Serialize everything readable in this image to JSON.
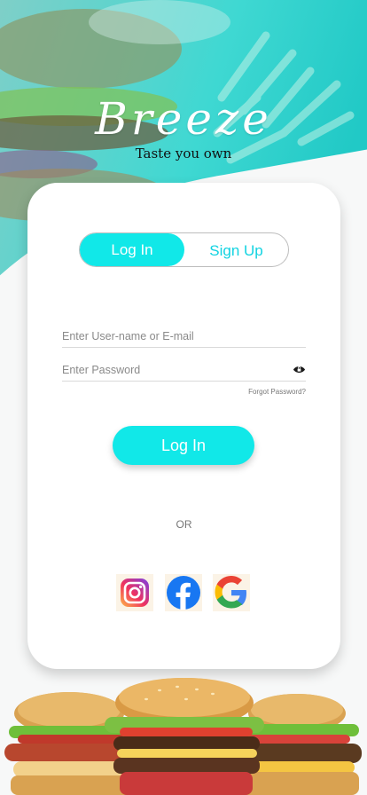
{
  "brand": {
    "title": "Breeze",
    "tagline": "Taste you own"
  },
  "auth_toggle": {
    "login_label": "Log In",
    "signup_label": "Sign Up",
    "active": "login"
  },
  "form": {
    "username_placeholder": "Enter User-name or E-mail",
    "password_placeholder": "Enter Password",
    "forgot_label": "Forgot Password?",
    "submit_label": "Log In"
  },
  "divider": {
    "label": "OR"
  },
  "social": [
    {
      "name": "instagram",
      "icon": "instagram-icon"
    },
    {
      "name": "facebook",
      "icon": "facebook-icon"
    },
    {
      "name": "google",
      "icon": "google-icon"
    }
  ],
  "colors": {
    "accent": "#11e8e8",
    "accent_text": "#12d3e1",
    "card": "#ffffff",
    "background": "#f7f8f8"
  }
}
